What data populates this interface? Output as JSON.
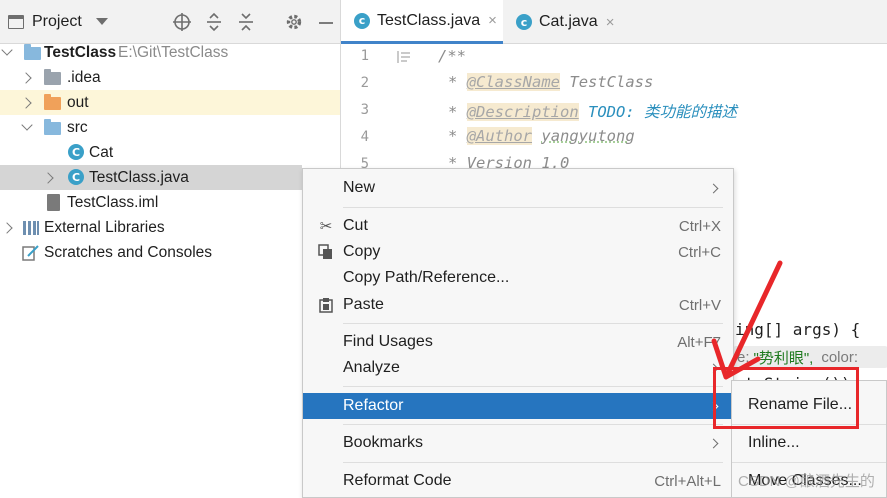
{
  "project_panel": {
    "title": "Project"
  },
  "tree": {
    "root_name": "TestClass",
    "root_path": "E:\\Git\\TestClass",
    "items": [
      {
        "label": ".idea"
      },
      {
        "label": "out"
      },
      {
        "label": "src"
      },
      {
        "label": "Cat"
      },
      {
        "label": "TestClass.java"
      },
      {
        "label": "TestClass.iml"
      },
      {
        "label": "External Libraries"
      },
      {
        "label": "Scratches and Consoles"
      }
    ]
  },
  "tabs": [
    {
      "label": "TestClass.java",
      "icon": "c",
      "close": "×"
    },
    {
      "label": "Cat.java",
      "icon": "c",
      "close": "×"
    }
  ],
  "editor": {
    "line_numbers": [
      "1",
      "2",
      "3",
      "4",
      "5"
    ],
    "line1": "/**",
    "line2_tag": "@ClassName",
    "line2_val": "TestClass",
    "line3_tag": "@Description",
    "line3_todo": "TODO",
    "line3_val": ": 类功能的描述",
    "line4_tag": "@Author",
    "line4_val": "yangyutong",
    "line5": "* Version 1.0",
    "star": "*",
    "visible_code_1": "ing[] args) {",
    "hint_prefix": "e:",
    "hint_string": "\"势利眼\",",
    "hint_suffix": "color:",
    "visible_code_2": ".toString());"
  },
  "context_menu": {
    "items": [
      {
        "label": "New",
        "shortcut": "",
        "submenu": true
      },
      {
        "label": "Cut",
        "shortcut": "Ctrl+X",
        "icon": "scissors-icon"
      },
      {
        "label": "Copy",
        "shortcut": "Ctrl+C",
        "icon": "copy-icon"
      },
      {
        "label": "Copy Path/Reference...",
        "shortcut": ""
      },
      {
        "label": "Paste",
        "shortcut": "Ctrl+V",
        "icon": "paste-icon"
      },
      {
        "label": "Find Usages",
        "shortcut": "Alt+F7"
      },
      {
        "label": "Analyze",
        "shortcut": "",
        "submenu": true
      },
      {
        "label": "Refactor",
        "shortcut": "",
        "submenu": true,
        "highlighted": true
      },
      {
        "label": "Bookmarks",
        "shortcut": "",
        "submenu": true
      },
      {
        "label": "Reformat Code",
        "shortcut": "Ctrl+Alt+L"
      }
    ]
  },
  "refactor_submenu": {
    "items": [
      {
        "label": "Rename File..."
      },
      {
        "label": "Inline..."
      },
      {
        "label": "Move Classes..."
      }
    ]
  },
  "watermark": "CSDN @酿酒先生的",
  "colors": {
    "selection_blue": "#2675bf",
    "annotation_red": "#e8272a",
    "class_icon": "#3aa0c8",
    "folder_blue": "#87b8dd",
    "folder_orange": "#f0a15a"
  }
}
